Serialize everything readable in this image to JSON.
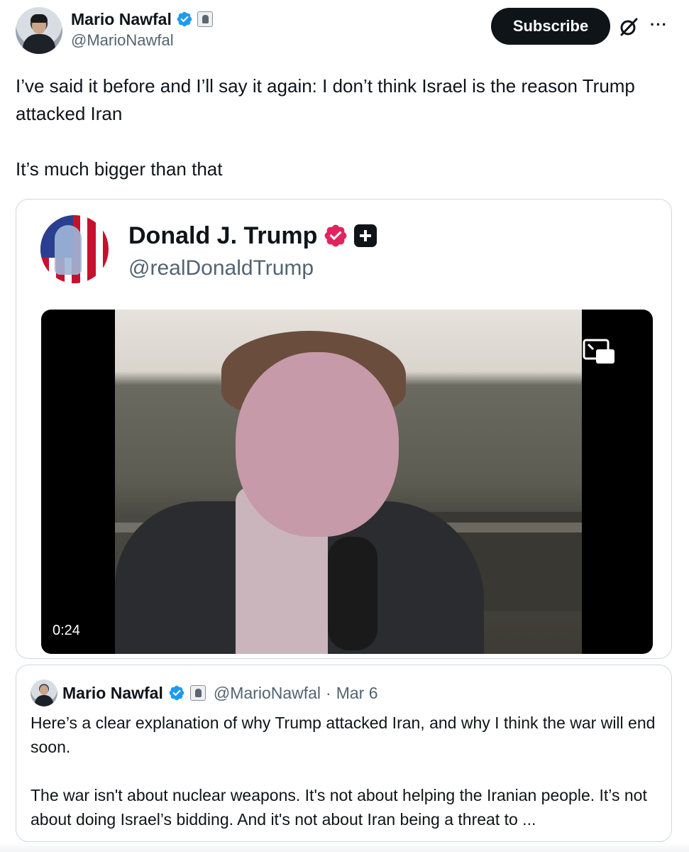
{
  "author": {
    "name": "Mario Nawfal",
    "handle": "@MarioNawfal",
    "verified_color": "#1d9bf0"
  },
  "actions": {
    "subscribe_label": "Subscribe",
    "grok_icon": "grok-icon",
    "more_label": "···"
  },
  "tweet": {
    "line1": "I’ve said it before and I’ll say it again: I don’t think Israel is the reason Trump attacked Iran",
    "line2": "It’s much bigger than that"
  },
  "media": {
    "name": "Donald J. Trump",
    "handle": "@realDonaldTrump",
    "verified_color": "#e0245e",
    "video_duration": "0:24",
    "pip_icon": "picture-in-picture-icon"
  },
  "quote": {
    "name": "Mario Nawfal",
    "handle": "@MarioNawfal",
    "separator": "·",
    "date": "Mar 6",
    "para1": "Here’s a clear explanation of why Trump attacked Iran, and why I think the war will end soon.",
    "para2": "The war isn't about nuclear weapons. It's not about helping the Iranian people. It’s not about doing Israel’s bidding. And it's not about Iran being a threat to ..."
  }
}
